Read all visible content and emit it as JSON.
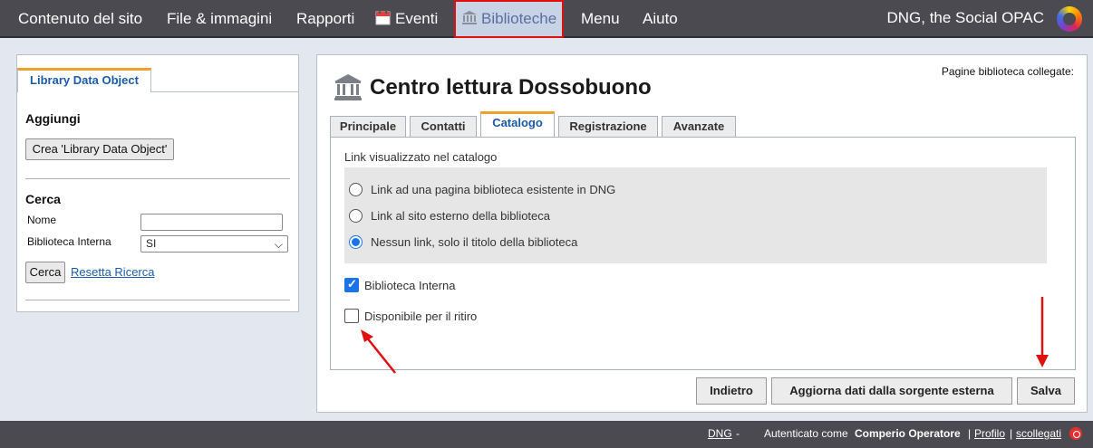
{
  "nav": {
    "items": [
      {
        "label": "Contenuto del sito"
      },
      {
        "label": "File & immagini"
      },
      {
        "label": "Rapporti"
      },
      {
        "label": "Eventi",
        "icon": "calendar-icon"
      },
      {
        "label": "Biblioteche",
        "icon": "bank-icon",
        "active": true
      },
      {
        "label": "Menu"
      },
      {
        "label": "Aiuto"
      }
    ],
    "brand": "DNG, the Social OPAC"
  },
  "sidebar": {
    "tab_label": "Library Data Object",
    "add_heading": "Aggiungi",
    "create_button": "Crea 'Library Data Object'",
    "search_heading": "Cerca",
    "name_label": "Nome",
    "name_value": "",
    "internal_label": "Biblioteca Interna",
    "internal_value": "SI",
    "search_button": "Cerca",
    "reset_link": "Resetta Ricerca"
  },
  "main": {
    "title": "Centro lettura Dossobuono",
    "linked_pages_label": "Pagine biblioteca collegate:",
    "tabs": [
      {
        "label": "Principale"
      },
      {
        "label": "Contatti"
      },
      {
        "label": "Catalogo",
        "active": true
      },
      {
        "label": "Registrazione"
      },
      {
        "label": "Avanzate"
      }
    ],
    "link_section_label": "Link visualizzato nel catalogo",
    "radio_options": [
      {
        "label": "Link ad una pagina biblioteca esistente in DNG",
        "checked": false
      },
      {
        "label": "Link al sito esterno della biblioteca",
        "checked": false
      },
      {
        "label": "Nessun link, solo il titolo della biblioteca",
        "checked": true
      }
    ],
    "checkboxes": [
      {
        "label": "Biblioteca Interna",
        "checked": true
      },
      {
        "label": "Disponibile per il ritiro",
        "checked": false
      }
    ],
    "buttons": {
      "back": "Indietro",
      "update": "Aggiorna dati dalla sorgente esterna",
      "save": "Salva"
    }
  },
  "footer": {
    "dng_link": "DNG",
    "separator": "-",
    "auth_prefix": "Autenticato come",
    "user": "Comperio Operatore",
    "profile_link": "Profilo",
    "logout_link": "scollegati"
  },
  "colors": {
    "topbar": "#4a4a50",
    "accent": "#1a5ca8",
    "tab_highlight": "#f0a030",
    "annotation": "#e01010"
  }
}
